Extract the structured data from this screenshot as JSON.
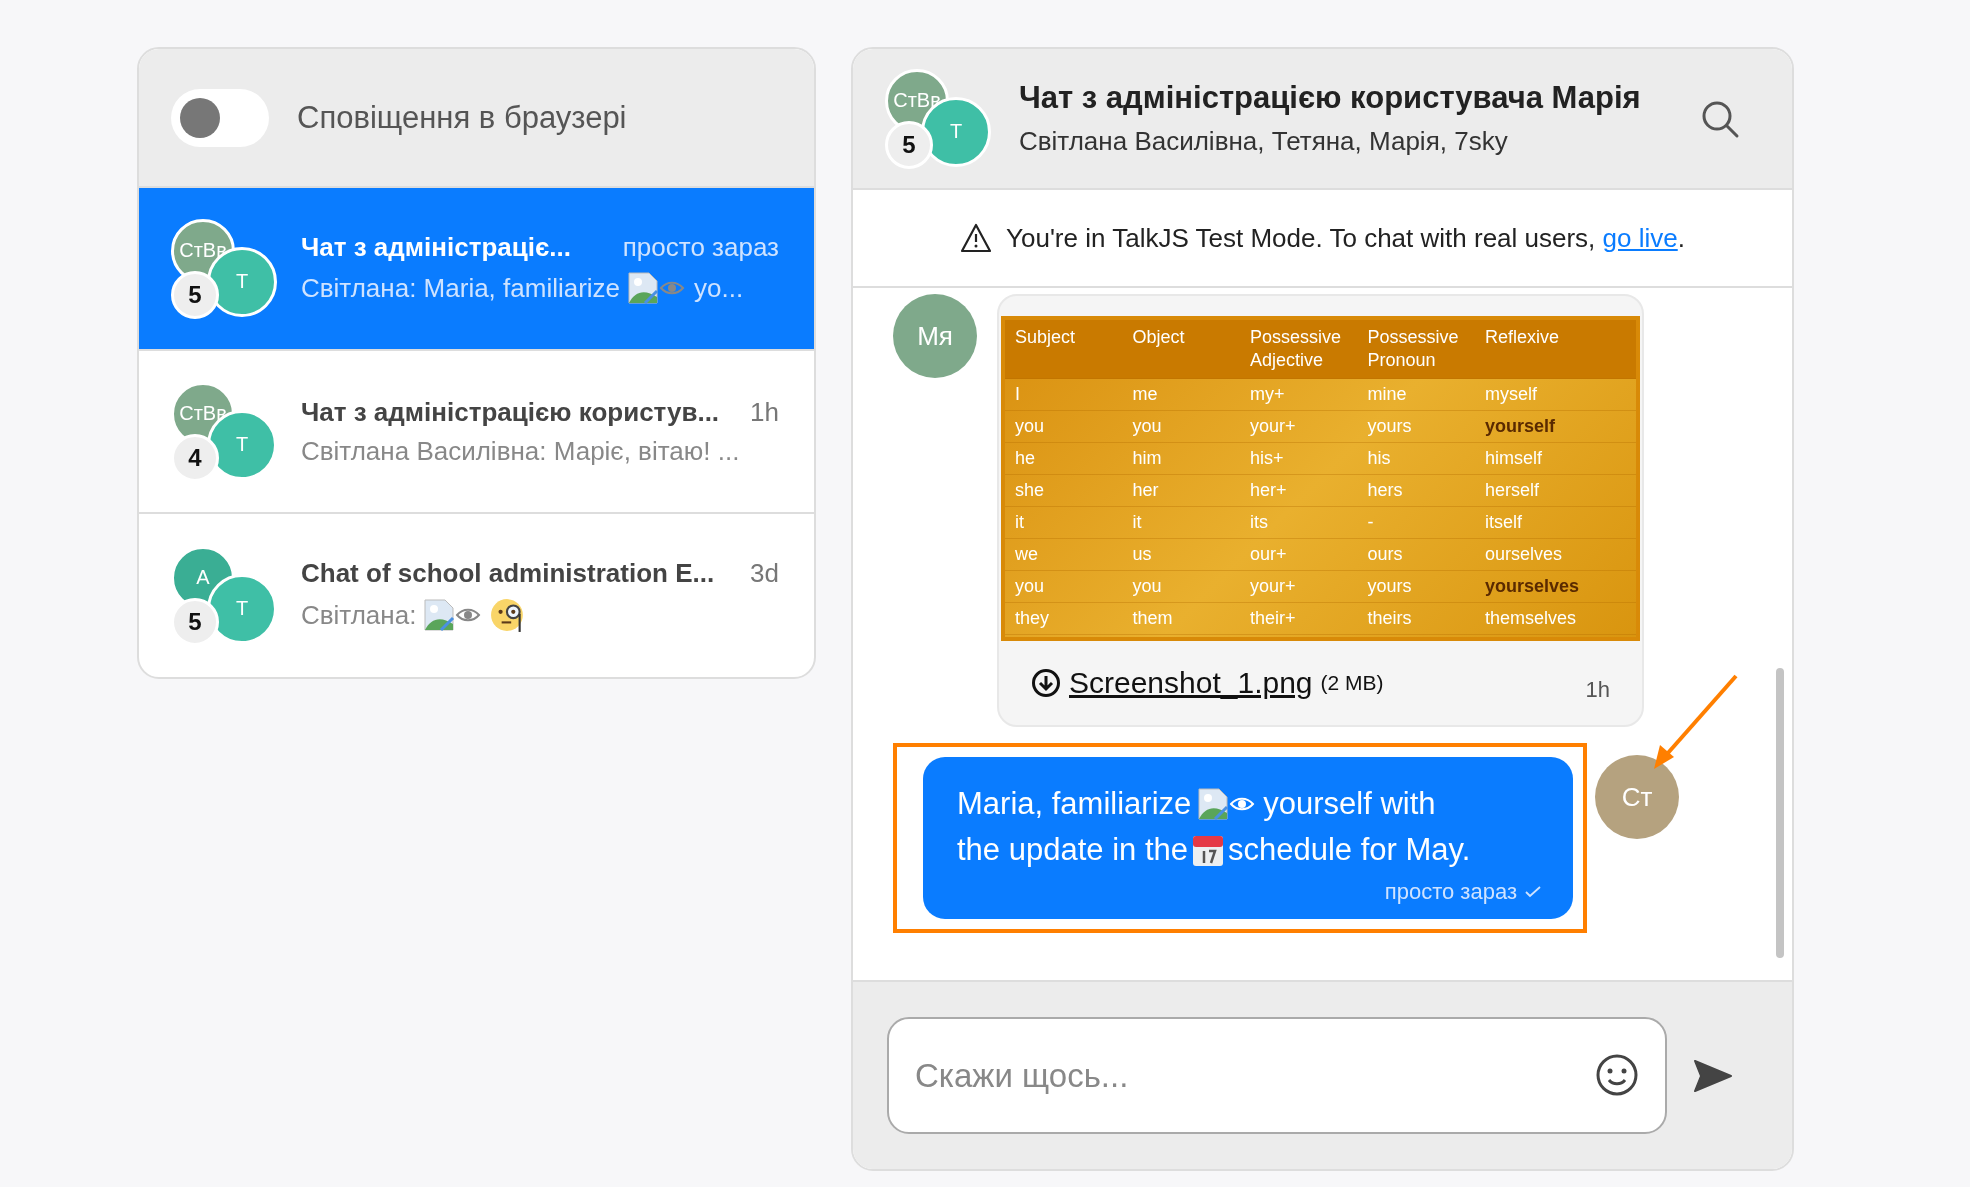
{
  "notifications": {
    "label": "Сповіщення в браузері",
    "on": false
  },
  "conversations": [
    {
      "selected": true,
      "title": "Чат з адміністраціє...",
      "time": "просто зараз",
      "badge": "5",
      "avatars": [
        {
          "initials": "СтВв",
          "color": "#7fa98b"
        },
        {
          "initials": "Т",
          "color": "#3fbfa6"
        }
      ],
      "preview": [
        {
          "kind": "text",
          "text": "Світлана: Maria, familiarize"
        },
        {
          "kind": "broken-image"
        },
        {
          "kind": "text",
          "text": "yo..."
        }
      ]
    },
    {
      "selected": false,
      "title": "Чат з адміністрацією користув...",
      "time": "1h",
      "badge": "4",
      "avatars": [
        {
          "initials": "СтВв",
          "color": "#7fa98b"
        },
        {
          "initials": "Т",
          "color": "#3fbfa6"
        }
      ],
      "preview": [
        {
          "kind": "text",
          "text": "Світлана Василівна: Маріє, вітаю! ..."
        }
      ]
    },
    {
      "selected": false,
      "title": "Chat of school administration E...",
      "time": "3d",
      "badge": "5",
      "avatars": [
        {
          "initials": "А",
          "color": "#3aae94"
        },
        {
          "initials": "Т",
          "color": "#3fbfa6"
        }
      ],
      "preview": [
        {
          "kind": "text",
          "text": "Світлана:"
        },
        {
          "kind": "broken-image"
        },
        {
          "kind": "monocle-emoji"
        }
      ]
    }
  ],
  "chat": {
    "title": "Чат з адміністрацією користувача Марія",
    "participants": "Світлана Василівна, Тетяна, Марія, 7sky",
    "badge": "5",
    "avatars": [
      {
        "initials": "СтВв",
        "color": "#7fa98b"
      },
      {
        "initials": "Т",
        "color": "#3fbfa6"
      }
    ]
  },
  "banner": {
    "text": "You're in TalkJS Test Mode. To chat with real users,",
    "link": "go live",
    "end": "."
  },
  "messages": [
    {
      "kind": "attachment",
      "avatar": {
        "initials": "Мя",
        "color": "#7fa98b"
      },
      "table": {
        "columns": [
          "Subject",
          "Object",
          "Possessive Adjective",
          "Possessive Pronoun",
          "Reflexive"
        ],
        "rows": [
          {
            "cells": [
              "I",
              "me",
              "my+",
              "mine",
              "myself"
            ],
            "emphasized": false
          },
          {
            "cells": [
              "you",
              "you",
              "your+",
              "yours",
              "yourself"
            ],
            "emphasized": true
          },
          {
            "cells": [
              "he",
              "him",
              "his+",
              "his",
              "himself"
            ],
            "emphasized": false
          },
          {
            "cells": [
              "she",
              "her",
              "her+",
              "hers",
              "herself"
            ],
            "emphasized": false
          },
          {
            "cells": [
              "it",
              "it",
              "its",
              "-",
              "itself"
            ],
            "emphasized": false
          },
          {
            "cells": [
              "we",
              "us",
              "our+",
              "ours",
              "ourselves"
            ],
            "emphasized": false
          },
          {
            "cells": [
              "you",
              "you",
              "your+",
              "yours",
              "yourselves"
            ],
            "emphasized": true
          },
          {
            "cells": [
              "they",
              "them",
              "their+",
              "theirs",
              "themselves"
            ],
            "emphasized": false
          }
        ]
      },
      "file": "Screenshot_1.png",
      "size": "(2 MB)",
      "time": "1h"
    },
    {
      "kind": "own",
      "avatar": {
        "initials": "Ст",
        "color": "#b5a27f"
      },
      "lines": [
        [
          {
            "kind": "text",
            "text": "Maria, familiarize"
          },
          {
            "kind": "broken-image"
          },
          {
            "kind": "text",
            "text": "yourself with"
          }
        ],
        [
          {
            "kind": "text",
            "text": "the update in the"
          },
          {
            "kind": "calendar-emoji"
          },
          {
            "kind": "text",
            "text": "schedule for May."
          }
        ]
      ],
      "time": "просто зараз",
      "read": true
    }
  ],
  "composer": {
    "placeholder": "Скажи щось..."
  }
}
